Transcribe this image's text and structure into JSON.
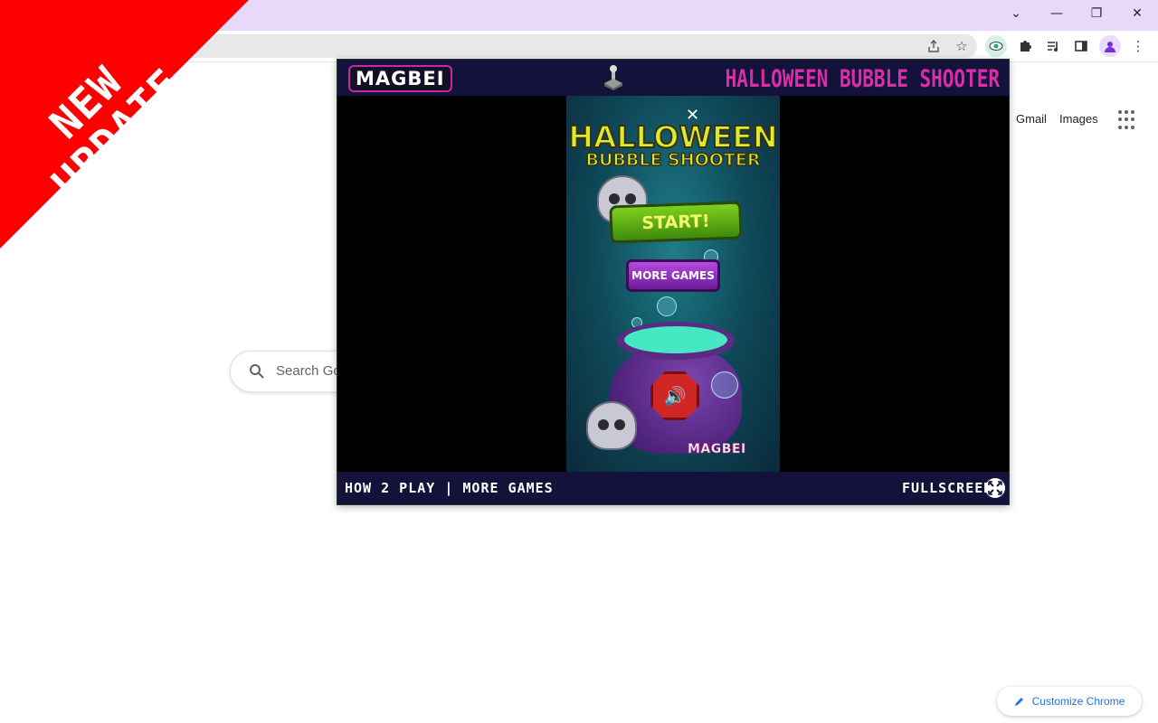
{
  "browser": {
    "window_buttons": {
      "tab_search": "⌄",
      "minimize": "—",
      "restore": "❐",
      "close": "✕"
    },
    "toolbar_icons": [
      "share-icon",
      "bookmark-star-icon",
      "extension-eye-icon",
      "extensions-puzzle-icon",
      "media-playlist-icon",
      "side-panel-icon",
      "profile-avatar-icon",
      "menu-kebab-icon"
    ]
  },
  "ntp": {
    "gmail_label": "Gmail",
    "images_label": "Images",
    "search_placeholder": "Search Go",
    "customize_label": "Customize Chrome"
  },
  "popup": {
    "brand": "MAGBEI",
    "title": "HALLOWEEN BUBBLE SHOOTER",
    "footer_left": "HOW 2 PLAY  |  MORE GAMES",
    "footer_right": "FULLSCREEN",
    "game": {
      "close": "✕",
      "title_line1": "HALLOWEEN",
      "title_line2": "BUBBLE SHOOTER",
      "start_label": "START!",
      "more_games_label": "MORE GAMES",
      "sound_icon": "🔊",
      "logo": "MAGBEI"
    }
  },
  "banner": {
    "line1": "NEW",
    "line2": "UPDATE",
    "color": "#ff0000"
  },
  "colors": {
    "titlebar": "#e8d9fb",
    "accent_blue": "#1a73e8",
    "magbei_pink": "#d82ea8"
  }
}
